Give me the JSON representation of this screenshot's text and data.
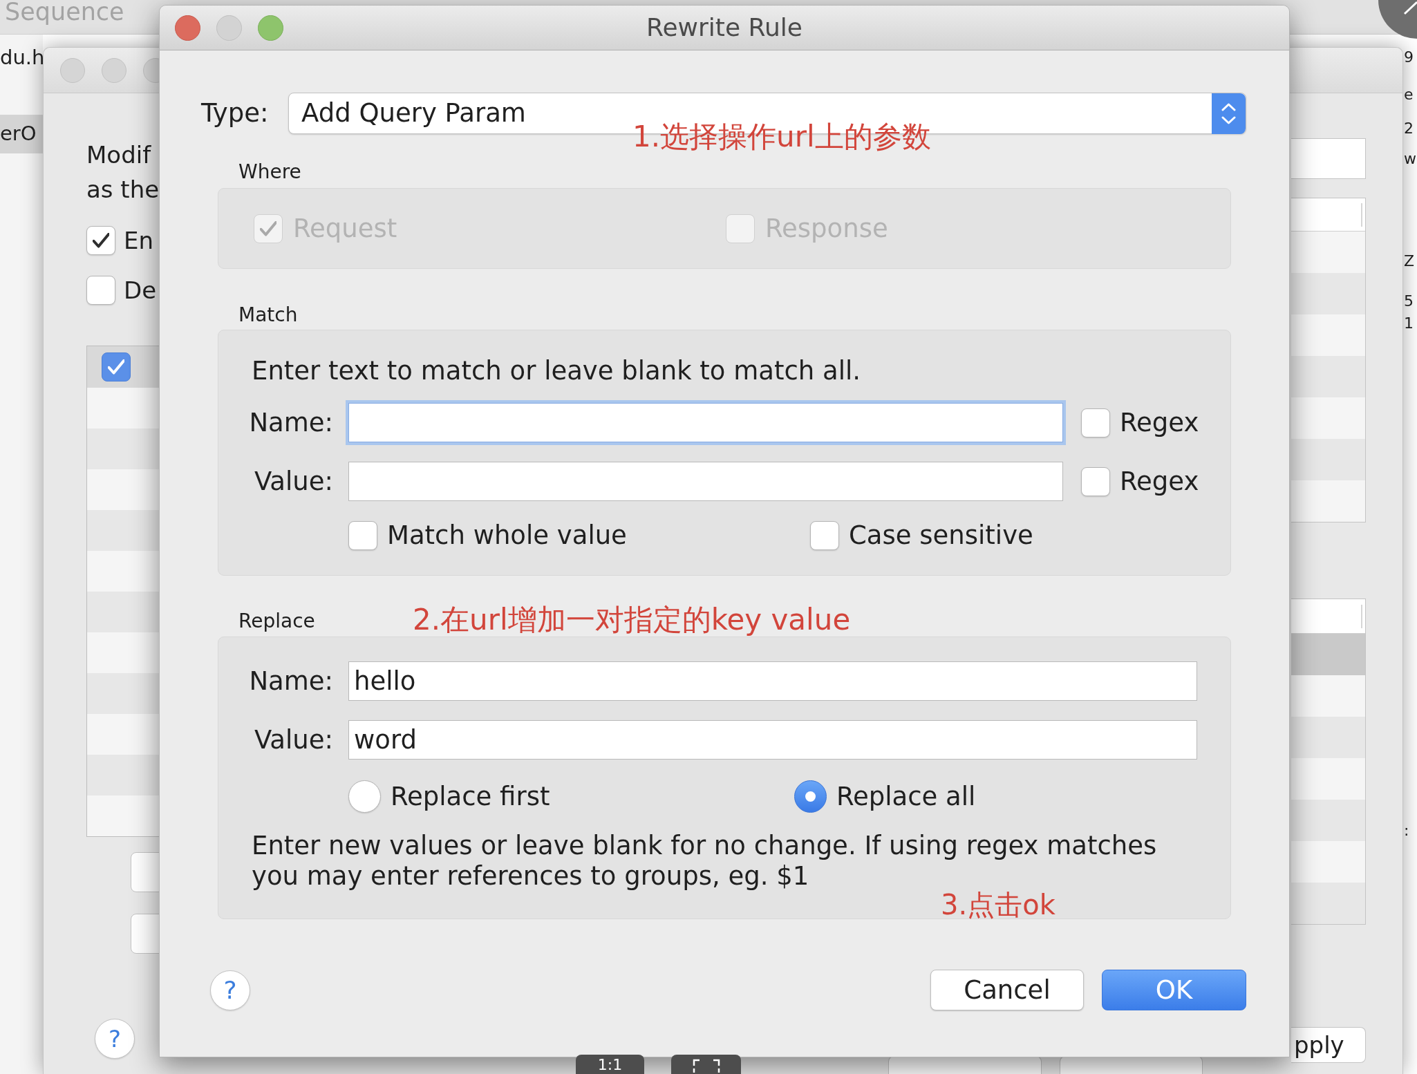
{
  "background": {
    "main_window": {
      "tab": "Sequence",
      "list_items": [
        {
          "label": "du.h",
          "selected": false
        },
        {
          "label": "erO",
          "selected": true
        }
      ],
      "edge_texts": [
        "9",
        "e",
        "2",
        "w",
        "Z",
        "5",
        "1",
        ":"
      ]
    },
    "settings_window": {
      "description": [
        "Modif",
        "as the"
      ],
      "options": [
        {
          "label": "En",
          "checked": true
        },
        {
          "label": "De",
          "checked": false
        }
      ],
      "table": {
        "select_all_checked": true
      },
      "right_table": {
        "rows": [
          {
            "selected": true
          },
          {
            "selected": false
          },
          {
            "selected": false
          },
          {
            "selected": false
          },
          {
            "selected": false
          },
          {
            "selected": false
          },
          {
            "selected": false
          }
        ]
      },
      "apply_button": "pply",
      "help_button": "?"
    },
    "viewer_controls": {
      "zoom_label": "1:1"
    }
  },
  "dialog": {
    "title": "Rewrite Rule",
    "type": {
      "label": "Type:",
      "value": "Add Query Param",
      "annotation": "1.选择操作url上的参数"
    },
    "where": {
      "title": "Where",
      "options": [
        {
          "label": "Request",
          "checked": true,
          "disabled": true
        },
        {
          "label": "Response",
          "checked": false,
          "disabled": true
        }
      ]
    },
    "match": {
      "title": "Match",
      "hint": "Enter text to match or leave blank to match all.",
      "fields": [
        {
          "label": "Name:",
          "focused": true,
          "regex": {
            "label": "Regex",
            "checked": false
          }
        },
        {
          "label": "Value:",
          "focused": false,
          "regex": {
            "label": "Regex",
            "checked": false
          }
        }
      ],
      "options": [
        {
          "label": "Match whole value",
          "checked": false
        },
        {
          "label": "Case sensitive",
          "checked": false
        }
      ]
    },
    "replace": {
      "title": "Replace",
      "annotation": "2.在url增加一对指定的key value",
      "fields": [
        {
          "label": "Name:",
          "value": "hello"
        },
        {
          "label": "Value:",
          "value": "word"
        }
      ],
      "modes": [
        {
          "label": "Replace first",
          "selected": false
        },
        {
          "label": "Replace all",
          "selected": true
        }
      ],
      "note": "Enter new values or leave blank for no change. If using regex matches you may enter references to groups, eg. $1",
      "note_annotation": "3.点击ok"
    },
    "help_button": "?",
    "buttons": [
      {
        "label": "Cancel",
        "kind": "secondary"
      },
      {
        "label": "OK",
        "kind": "primary"
      }
    ]
  }
}
